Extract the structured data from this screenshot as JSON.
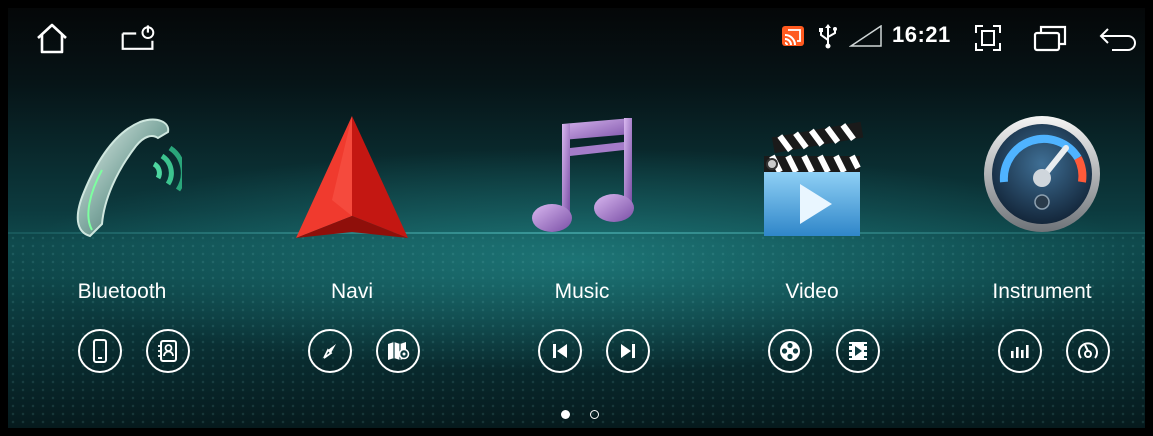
{
  "statusbar": {
    "home": "home-icon",
    "power": "screen-off-icon",
    "cast": "cast-icon",
    "usb": "usb-icon",
    "signal": "signal-icon",
    "time": "16:21",
    "screenshot": "fullscreen-icon",
    "recents": "recent-apps-icon",
    "back": "back-icon",
    "accent": "#ff5a1f"
  },
  "apps": [
    {
      "label": "Bluetooth",
      "icon": "phone-icon",
      "buttons": [
        "smartphone-icon",
        "contacts-icon"
      ]
    },
    {
      "label": "Navi",
      "icon": "navigation-arrow-icon",
      "buttons": [
        "compass-icon",
        "map-icon"
      ]
    },
    {
      "label": "Music",
      "icon": "music-note-icon",
      "buttons": [
        "previous-track-icon",
        "next-track-icon"
      ]
    },
    {
      "label": "Video",
      "icon": "clapperboard-icon",
      "buttons": [
        "film-reel-icon",
        "video-file-icon"
      ]
    },
    {
      "label": "Instrument",
      "icon": "gauge-icon",
      "buttons": [
        "equalizer-icon",
        "speedometer-icon"
      ]
    }
  ],
  "pager": {
    "pages": 2,
    "current": 1
  }
}
